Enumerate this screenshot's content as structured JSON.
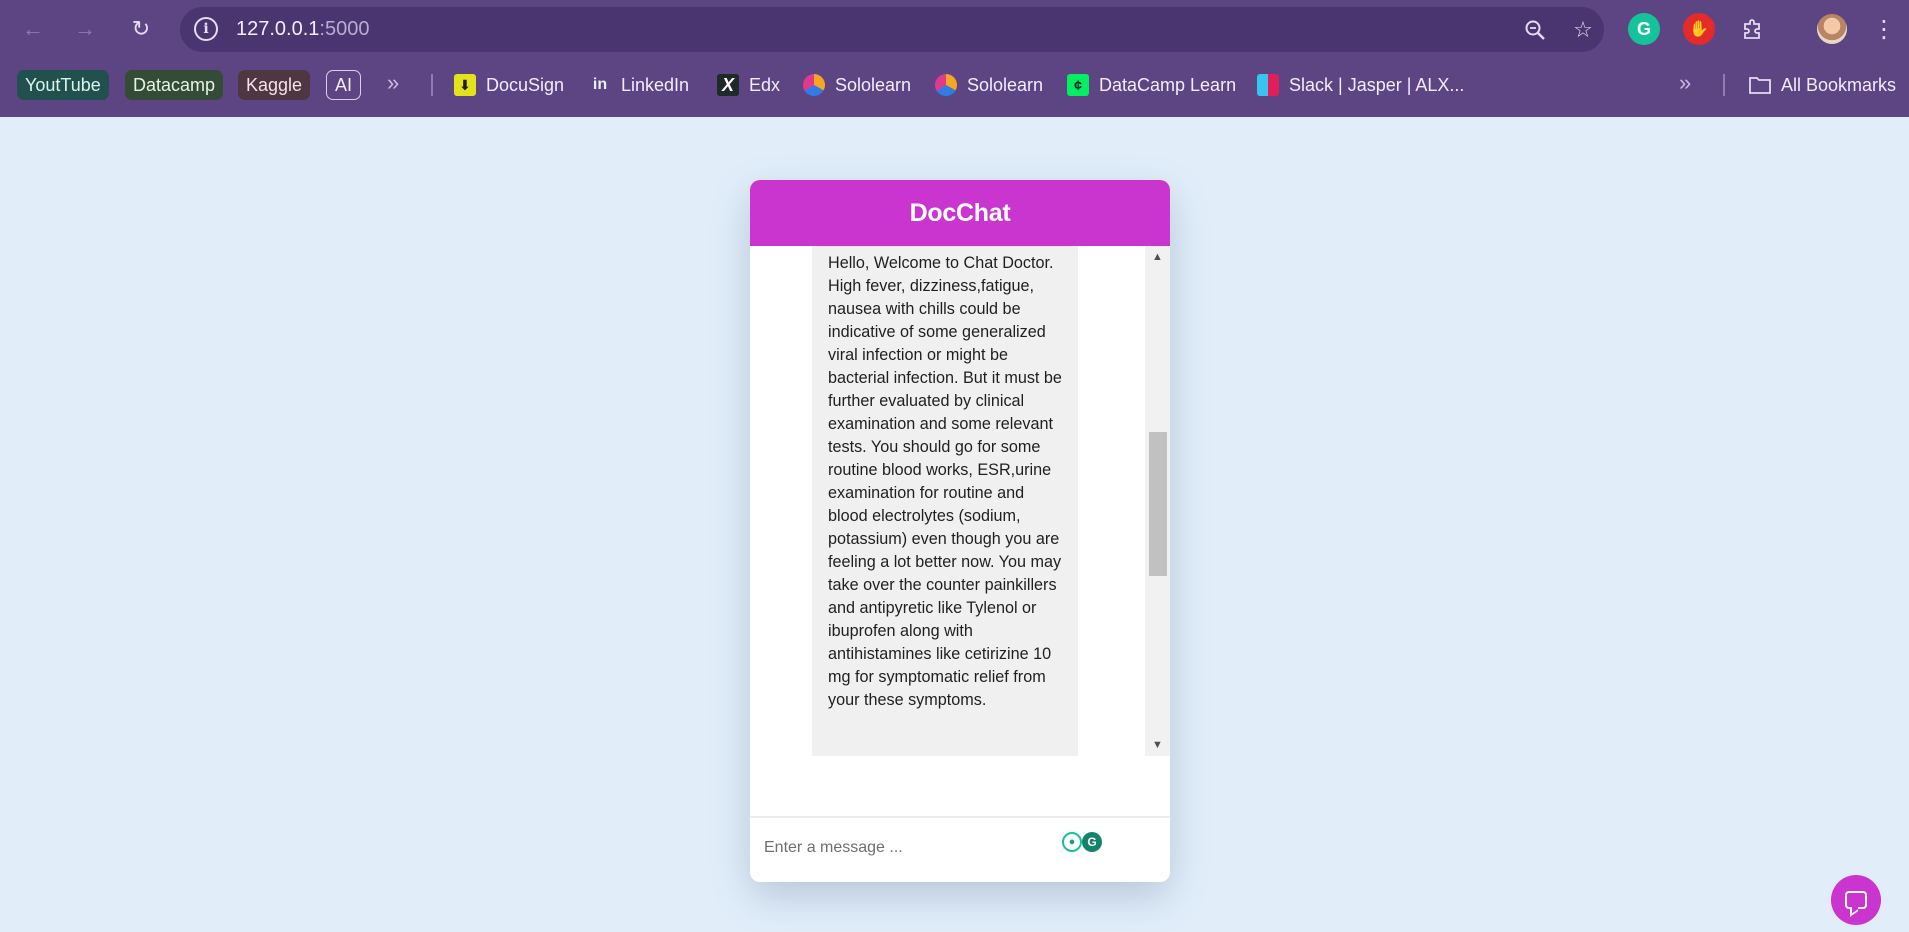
{
  "browser": {
    "url_host": "127.0.0.1",
    "url_port": ":5000",
    "icons": {
      "back": "arrow-left-icon",
      "forward": "arrow-right-icon",
      "reload": "reload-icon",
      "info": "info-icon",
      "zoom": "zoom-icon",
      "star": "star-icon",
      "menu": "kebab-menu-icon"
    },
    "colors": {
      "chrome": "#5d4584",
      "omnibox": "#4a3570"
    }
  },
  "bookmarks": {
    "tags": [
      "YoutTube",
      "Datacamp",
      "Kaggle",
      "AI"
    ],
    "more_glyph": "»",
    "items": [
      "DocuSign",
      "LinkedIn",
      "Edx",
      "Sololearn",
      "Sololearn",
      "DataCamp Learn",
      "Slack | Jasper | ALX..."
    ],
    "all_bookmarks": "All Bookmarks"
  },
  "extensions": {
    "grammarly": "G",
    "stop": "✋",
    "puzzle": "puzzle-icon"
  },
  "app": {
    "title": "DocChat",
    "accent": "#cb35cf",
    "message": "Hello, Welcome to Chat Doctor. High fever, dizziness,fatigue, nausea with chills could be indicative of some generalized viral infection or might be bacterial infection. But it must be further evaluated by clinical examination and some relevant tests. You should go for some routine blood works, ESR,urine examination for routine and blood electrolytes (sodium, potassium) even though you are feeling a lot better now. You may take over the counter painkillers and antipyretic like Tylenol or ibuprofen along with antihistamines like cetirizine 10 mg for symptomatic relief from your these symptoms.",
    "input_placeholder": "Enter a message ...",
    "scroll_up": "▲",
    "scroll_down": "▼"
  }
}
